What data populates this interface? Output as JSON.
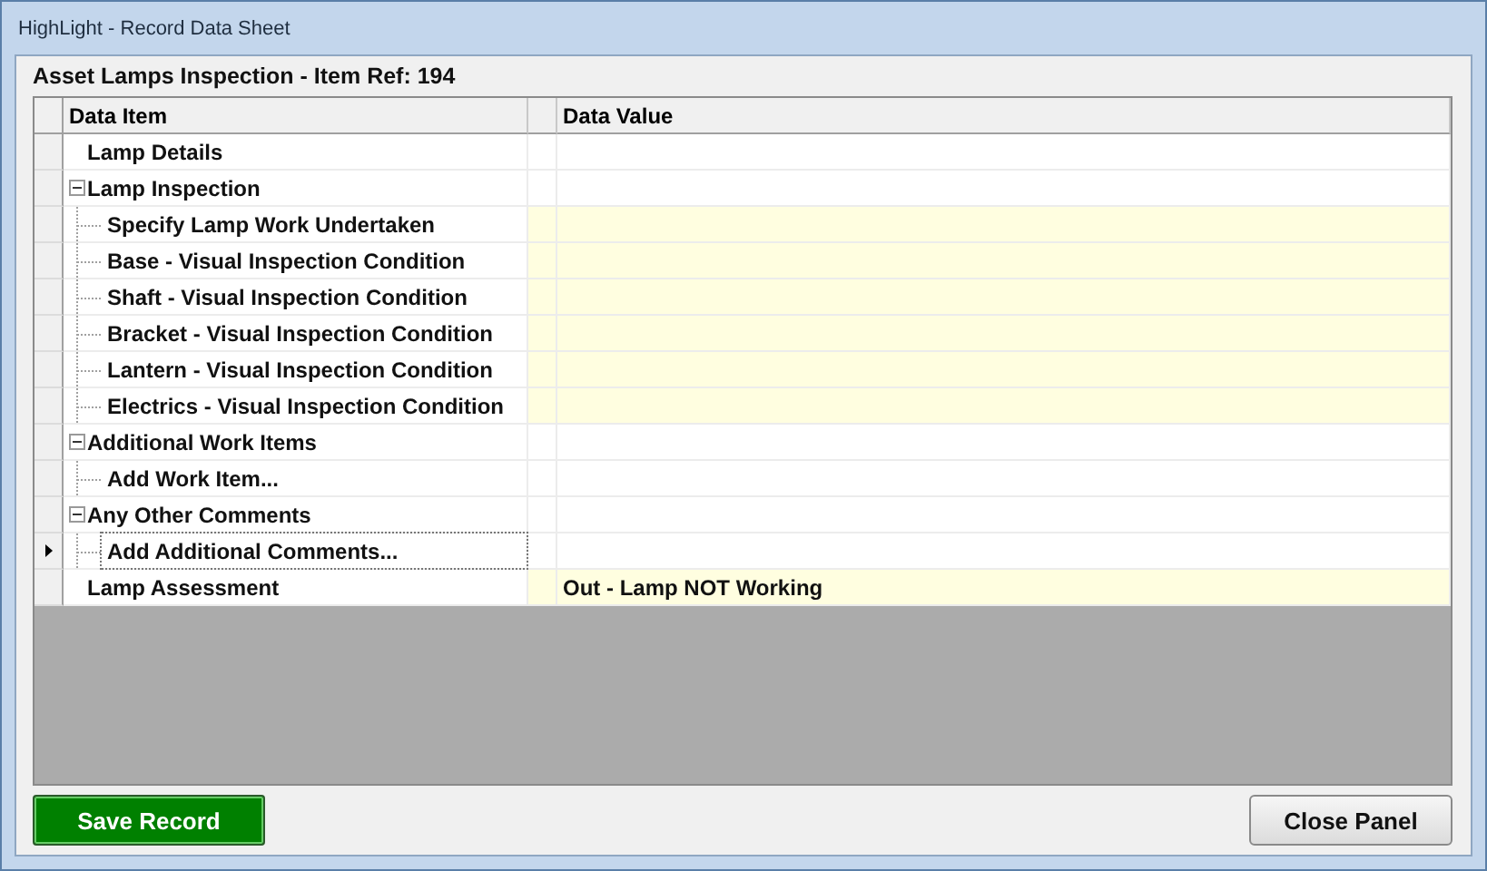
{
  "window": {
    "title": "HighLight - Record Data Sheet"
  },
  "heading": "Asset Lamps Inspection - Item Ref: 194",
  "grid": {
    "columns": [
      "Data Item",
      "Data Value"
    ],
    "rows": [
      {
        "label": "Lamp Details",
        "editable": false,
        "selected": false
      },
      {
        "label": "Lamp Inspection",
        "editable": false,
        "selected": false,
        "expanded": true,
        "children": [
          {
            "label": "Specify Lamp Work Undertaken",
            "editable": true,
            "selected": false
          },
          {
            "label": "Base - Visual Inspection Condition",
            "editable": true,
            "selected": false
          },
          {
            "label": "Shaft - Visual Inspection Condition",
            "editable": true,
            "selected": false
          },
          {
            "label": "Bracket - Visual Inspection Condition",
            "editable": true,
            "selected": false
          },
          {
            "label": "Lantern - Visual Inspection Condition",
            "editable": true,
            "selected": false
          },
          {
            "label": "Electrics - Visual Inspection Condition",
            "editable": true,
            "selected": false
          }
        ]
      },
      {
        "label": "Additional Work Items",
        "editable": false,
        "selected": false,
        "expanded": true,
        "children": [
          {
            "label": "Add Work Item...",
            "editable": false,
            "selected": false
          }
        ]
      },
      {
        "label": "Any Other Comments",
        "editable": false,
        "selected": false,
        "expanded": true,
        "children": [
          {
            "label": "Add Additional Comments...",
            "editable": false,
            "selected": true
          }
        ]
      },
      {
        "label": "Lamp Assessment",
        "editable": true,
        "selected": false,
        "value": "Out - Lamp NOT Working"
      }
    ]
  },
  "buttons": {
    "save": "Save Record",
    "close": "Close Panel"
  }
}
